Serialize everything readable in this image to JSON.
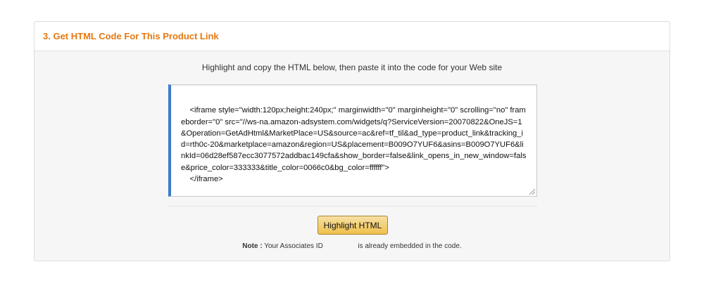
{
  "panel": {
    "title": "3. Get HTML Code For This Product Link",
    "instruction": "Highlight and copy the HTML below, then paste it into the code for your Web site",
    "code": "<iframe style=\"width:120px;height:240px;\" marginwidth=\"0\" marginheight=\"0\" scrolling=\"no\" frameborder=\"0\" src=\"//ws-na.amazon-adsystem.com/widgets/q?ServiceVersion=20070822&OneJS=1&Operation=GetAdHtml&MarketPlace=US&source=ac&ref=tf_til&ad_type=product_link&tracking_id=rth0c-20&marketplace=amazon&region=US&placement=B009O7YUF6&asins=B009O7YUF6&linkId=06d28ef587ecc3077572addbac149cfa&show_border=false&link_opens_in_new_window=false&price_color=333333&title_color=0066c0&bg_color=ffffff\">\n    </iframe>",
    "button_label": "Highlight HTML",
    "note": {
      "label": "Note :",
      "before": " Your Associates ID ",
      "after": " is already embedded in the code."
    }
  },
  "colors": {
    "title": "#e47911",
    "accent_border": "#3d7cc9",
    "button_bg": "#f0c14b"
  }
}
